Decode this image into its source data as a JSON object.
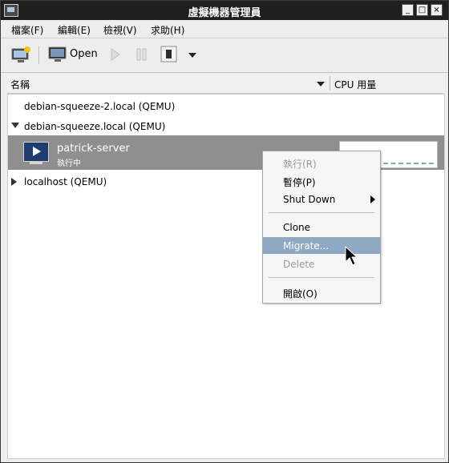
{
  "window": {
    "title": "虛擬機器管理員"
  },
  "menubar": {
    "items": [
      {
        "label": "檔案(F)"
      },
      {
        "label": "編輯(E)"
      },
      {
        "label": "檢視(V)"
      },
      {
        "label": "求助(H)"
      }
    ]
  },
  "toolbar": {
    "open_label": "Open"
  },
  "columns": {
    "name": "名稱",
    "cpu": "CPU 用量"
  },
  "connections": [
    {
      "label": "debian-squeeze-2.local (QEMU)"
    },
    {
      "label": "debian-squeeze.local (QEMU)"
    },
    {
      "label": "localhost (QEMU)"
    }
  ],
  "vm": {
    "name": "patrick-server",
    "status": "執行中"
  },
  "context_menu": {
    "items": [
      {
        "label": "執行(R)",
        "disabled": true
      },
      {
        "label": "暫停(P)"
      },
      {
        "label": "Shut Down"
      },
      {
        "label": "Clone"
      },
      {
        "label": "Migrate..."
      },
      {
        "label": "Delete",
        "disabled": true
      },
      {
        "label": "開啟(O)"
      }
    ]
  },
  "colors": {
    "titlebar": "#1f1f1f",
    "selection": "#8f8f8f",
    "menu_active": "#8fa9c2",
    "cpu_graph": "#7fb0b3"
  },
  "icons": [
    "app-icon",
    "minimize-icon",
    "maximize-icon",
    "close-icon",
    "new-connection-icon",
    "monitor-icon",
    "run-icon",
    "pause-icon",
    "shutdown-icon",
    "dropdown-icon",
    "vm-running-icon",
    "mouse-cursor-icon"
  ]
}
